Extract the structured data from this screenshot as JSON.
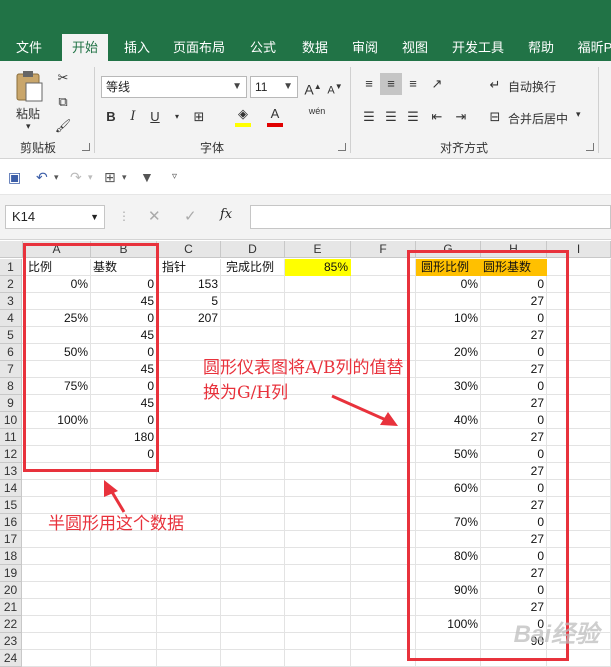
{
  "ribbon_tabs": [
    "文件",
    "开始",
    "插入",
    "页面布局",
    "公式",
    "数据",
    "审阅",
    "视图",
    "开发工具",
    "帮助",
    "福昕P"
  ],
  "active_tab": "开始",
  "clipboard": {
    "paste": "粘贴",
    "label": "剪贴板"
  },
  "font": {
    "name": "等线",
    "size": "11",
    "label": "字体",
    "bold": "B",
    "italic": "I",
    "underline": "U",
    "color_letter": "A",
    "wen": "wén"
  },
  "alignment": {
    "wrap": "自动换行",
    "merge": "合并后居中",
    "label": "对齐方式"
  },
  "name_box": "K14",
  "fx": "fx",
  "columns": [
    "A",
    "B",
    "C",
    "D",
    "E",
    "F",
    "G",
    "H",
    "I"
  ],
  "rows": [
    "1",
    "2",
    "3",
    "4",
    "5",
    "6",
    "7",
    "8",
    "9",
    "10",
    "11",
    "12",
    "13",
    "14",
    "15",
    "16",
    "17",
    "18",
    "19",
    "20",
    "21",
    "22",
    "23",
    "24"
  ],
  "cells": {
    "A": {
      "1": "比例",
      "2": "0%",
      "4": "25%",
      "6": "50%",
      "8": "75%",
      "10": "100%"
    },
    "B": {
      "1": "基数",
      "2": "0",
      "3": "45",
      "4": "0",
      "5": "45",
      "6": "0",
      "7": "45",
      "8": "0",
      "9": "45",
      "10": "0",
      "11": "180",
      "12": "0"
    },
    "C": {
      "1": "指针",
      "2": "153",
      "3": "5",
      "4": "207"
    },
    "D": {
      "1": "完成比例"
    },
    "E": {
      "1": "85%"
    },
    "G": {
      "1": "圆形比例",
      "2": "0%",
      "4": "10%",
      "6": "20%",
      "8": "30%",
      "10": "40%",
      "12": "50%",
      "14": "60%",
      "16": "70%",
      "18": "80%",
      "20": "90%",
      "22": "100%"
    },
    "H": {
      "1": "圆形基数",
      "2": "0",
      "3": "27",
      "4": "0",
      "5": "27",
      "6": "0",
      "7": "27",
      "8": "0",
      "9": "27",
      "10": "0",
      "11": "27",
      "12": "0",
      "13": "27",
      "14": "0",
      "15": "27",
      "16": "0",
      "17": "27",
      "18": "0",
      "19": "27",
      "20": "0",
      "21": "27",
      "22": "0",
      "23": "90"
    }
  },
  "annotations": {
    "replace_note": "圆形仪表图将A/B列的值替换为G/H列",
    "semicircle_note": "半圆形用这个数据"
  },
  "watermark": "Bai经验",
  "colors": {
    "excel_green": "#217346",
    "highlight_yellow": "#ffff00",
    "header_orange": "#ffc000",
    "annotation_red": "#e8323c"
  }
}
